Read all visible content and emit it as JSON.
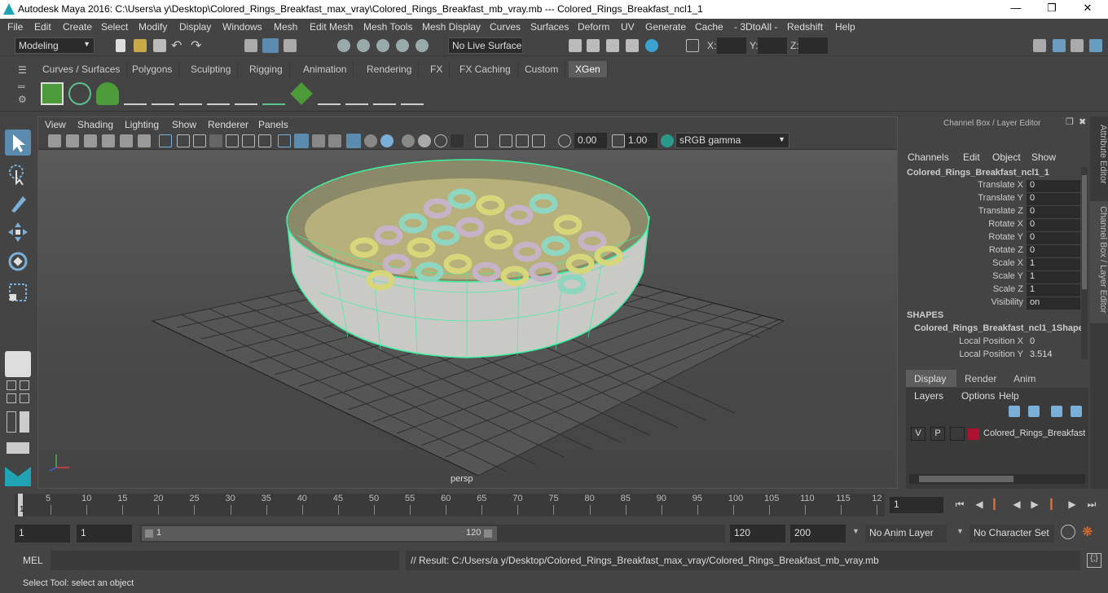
{
  "title": "Autodesk Maya 2016: C:\\Users\\a y\\Desktop\\Colored_Rings_Breakfast_max_vray\\Colored_Rings_Breakfast_mb_vray.mb   ---   Colored_Rings_Breakfast_ncl1_1",
  "menus": [
    "File",
    "Edit",
    "Create",
    "Select",
    "Modify",
    "Display",
    "Windows",
    "Mesh",
    "Edit Mesh",
    "Mesh Tools",
    "Mesh Display",
    "Curves",
    "Surfaces",
    "Deform",
    "UV",
    "Generate",
    "Cache",
    "- 3DtoAll -",
    "Redshift",
    "Help"
  ],
  "status": {
    "mode": "Modeling",
    "live_surface": "No Live Surface",
    "x_label": "X:",
    "y_label": "Y:",
    "z_label": "Z:"
  },
  "shelf_tabs": [
    "Curves / Surfaces",
    "Polygons",
    "Sculpting",
    "Rigging",
    "Animation",
    "Rendering",
    "FX",
    "FX Caching",
    "Custom",
    "XGen"
  ],
  "shelf_active": "XGen",
  "viewport": {
    "menus": [
      "View",
      "Shading",
      "Lighting",
      "Show",
      "Renderer",
      "Panels"
    ],
    "exposure": "0.00",
    "gamma": "1.00",
    "color_space": "sRGB gamma",
    "camera_label": "persp"
  },
  "channel_box": {
    "header": "Channel Box / Layer Editor",
    "menus": [
      "Channels",
      "Edit",
      "Object",
      "Show"
    ],
    "object_name": "Colored_Rings_Breakfast_ncl1_1",
    "attributes": [
      {
        "label": "Translate X",
        "value": "0"
      },
      {
        "label": "Translate Y",
        "value": "0"
      },
      {
        "label": "Translate Z",
        "value": "0"
      },
      {
        "label": "Rotate X",
        "value": "0"
      },
      {
        "label": "Rotate Y",
        "value": "0"
      },
      {
        "label": "Rotate Z",
        "value": "0"
      },
      {
        "label": "Scale X",
        "value": "1"
      },
      {
        "label": "Scale Y",
        "value": "1"
      },
      {
        "label": "Scale Z",
        "value": "1"
      },
      {
        "label": "Visibility",
        "value": "on"
      }
    ],
    "shapes_header": "SHAPES",
    "shape_name": "Colored_Rings_Breakfast_ncl1_1Shape",
    "shape_attributes": [
      {
        "label": "Local Position X",
        "value": "0"
      },
      {
        "label": "Local Position Y",
        "value": "3.514"
      }
    ]
  },
  "layer_editor": {
    "tabs": [
      "Display",
      "Render",
      "Anim"
    ],
    "active_tab": "Display",
    "menus": [
      "Layers",
      "Options",
      "Help"
    ],
    "layer": {
      "v": "V",
      "p": "P",
      "name": "Colored_Rings_Breakfast",
      "color": "#b01030"
    }
  },
  "side_tabs": [
    "Attribute Editor",
    "Channel Box / Layer Editor"
  ],
  "timeline": {
    "ticks": [
      "5",
      "10",
      "15",
      "20",
      "25",
      "30",
      "35",
      "40",
      "45",
      "50",
      "55",
      "60",
      "65",
      "70",
      "75",
      "80",
      "85",
      "90",
      "95",
      "100",
      "105",
      "110",
      "115",
      "12"
    ],
    "start_marker": "1",
    "current_frame": "1"
  },
  "range": {
    "start": "1",
    "playback_start": "1",
    "slider_start": "1",
    "slider_end": "120",
    "playback_end": "120",
    "end": "200",
    "anim_layer": "No Anim Layer",
    "character_set": "No Character Set"
  },
  "command": {
    "label": "MEL",
    "result": "// Result: C:/Users/a y/Desktop/Colored_Rings_Breakfast_max_vray/Colored_Rings_Breakfast_mb_vray.mb"
  },
  "help_line": "Select Tool: select an object",
  "colors": {
    "accent": "#5dbf8f",
    "wire": "#3cf0a0",
    "bg": "#444444"
  }
}
